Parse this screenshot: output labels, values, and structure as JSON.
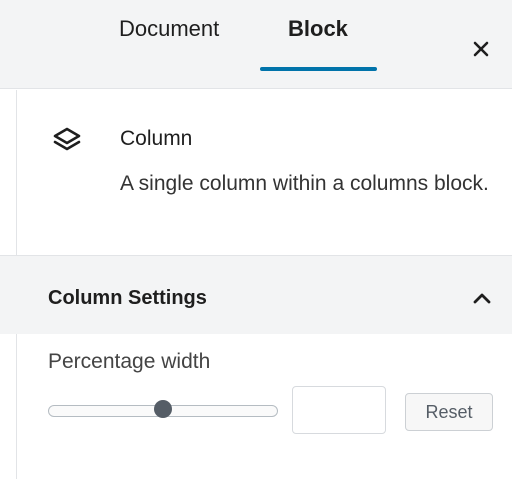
{
  "tabs": {
    "document_label": "Document",
    "block_label": "Block",
    "active": "Block"
  },
  "close": {
    "icon": "close-icon"
  },
  "block_card": {
    "icon": "column-stack-icon",
    "title": "Column",
    "description": "A single column within a columns block."
  },
  "settings": {
    "title": "Column Settings",
    "expanded": true,
    "toggle_icon": "chevron-up-icon"
  },
  "percentage_width": {
    "label": "Percentage width",
    "slider_fraction": 0.5,
    "value": "",
    "reset_label": "Reset"
  },
  "colors": {
    "accent": "#0073aa",
    "header_bg": "#f3f4f5",
    "border": "#e2e4e7",
    "thumb": "#555d66"
  }
}
